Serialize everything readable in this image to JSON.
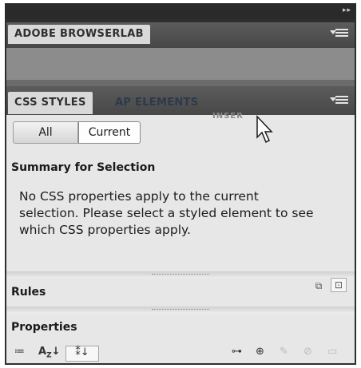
{
  "browserlab_panel": {
    "tab_label": "ADOBE BROWSERLAB"
  },
  "css_panel": {
    "tabs": [
      {
        "label": "CSS STYLES"
      },
      {
        "label": "AP ELEMENTS"
      }
    ],
    "ghost_tab_label": "INSER",
    "mode_buttons": {
      "all": "All",
      "current": "Current"
    },
    "summary_title": "Summary for Selection",
    "message_line1": "No CSS properties apply to the current",
    "message_line2": "selection.  Please select a styled element to see",
    "message_line3": "which CSS properties apply.",
    "rules_title": "Rules",
    "properties_title": "Properties",
    "property_view_icons": [
      "category-view-icon",
      "alphabetical-view-icon",
      "set-properties-view-icon"
    ],
    "bottom_action_icons": [
      "attach-stylesheet-icon",
      "new-css-rule-icon",
      "edit-style-icon",
      "disable-icon",
      "delete-css-icon"
    ]
  },
  "colors": {
    "panel_bg": "#e7e7e7",
    "tabbar_bg": "#4f4f4f",
    "inactive_tab_text": "#2b3a4c"
  }
}
